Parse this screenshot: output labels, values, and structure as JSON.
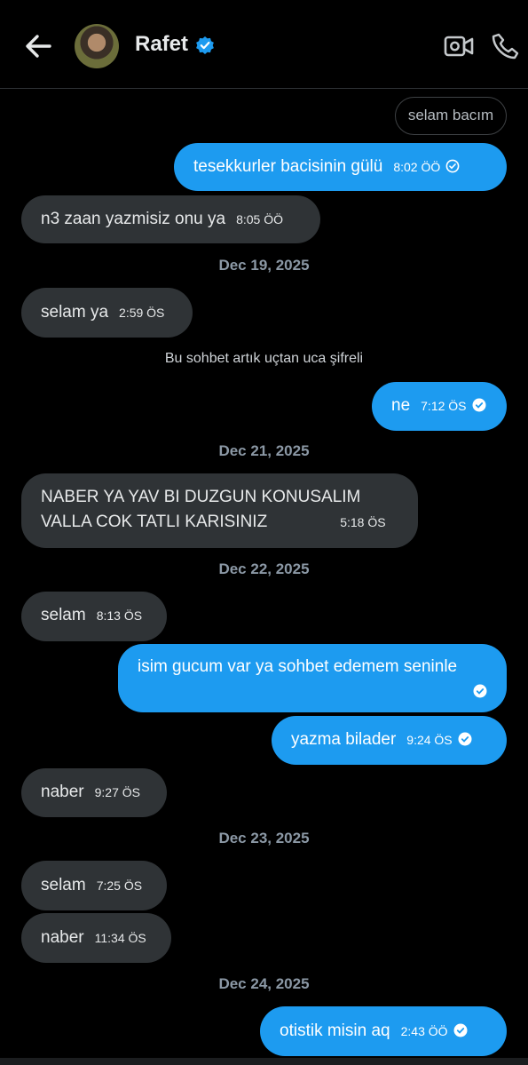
{
  "header": {
    "contact_name": "Rafet",
    "back_icon": "arrow-left-icon",
    "verified_icon": "verified-badge-icon",
    "video_icon": "video-call-icon",
    "call_icon": "phone-icon"
  },
  "colors": {
    "outgoing_bubble": "#1d9bf0",
    "incoming_bubble": "#2f3336",
    "background": "#000000",
    "verified": "#1d9bf0"
  },
  "reply_chip": "selam bacım",
  "messages": [
    {
      "text": "tesekkurler bacisinin gülü",
      "time": "8:02 ÖÖ",
      "direction": "out"
    },
    {
      "text": "n3 zaan yazmisiz onu ya",
      "time": "8:05 ÖÖ",
      "direction": "in"
    },
    {
      "text": "selam ya",
      "time": "2:59 ÖS",
      "direction": "in"
    },
    {
      "text": "ne",
      "time": "7:12 ÖS",
      "direction": "out"
    },
    {
      "text_line1": "NABER YA YAV BI DUZGUN KONUSALIM",
      "text_line2": "VALLA COK TATLI KARISINIZ",
      "time": "5:18 ÖS",
      "direction": "in"
    },
    {
      "text": "selam",
      "time": "8:13 ÖS",
      "direction": "in"
    },
    {
      "text": "isim gucum var ya sohbet edemem seninle",
      "time": "",
      "direction": "out"
    },
    {
      "text": "yazma bilader",
      "time": "9:24 ÖS",
      "direction": "out"
    },
    {
      "text": "naber",
      "time": "9:27 ÖS",
      "direction": "in"
    },
    {
      "text": "selam",
      "time": "7:25 ÖS",
      "direction": "in"
    },
    {
      "text": "naber",
      "time": "11:34 ÖS",
      "direction": "in"
    },
    {
      "text": "otistik misin aq",
      "time": "2:43 ÖÖ",
      "direction": "out"
    }
  ],
  "dates": [
    "Dec 19, 2025",
    "Dec 21, 2025",
    "Dec 22, 2025",
    "Dec 23, 2025",
    "Dec 24, 2025"
  ],
  "system_notice": "Bu sohbet artık uçtan uca şifreli"
}
